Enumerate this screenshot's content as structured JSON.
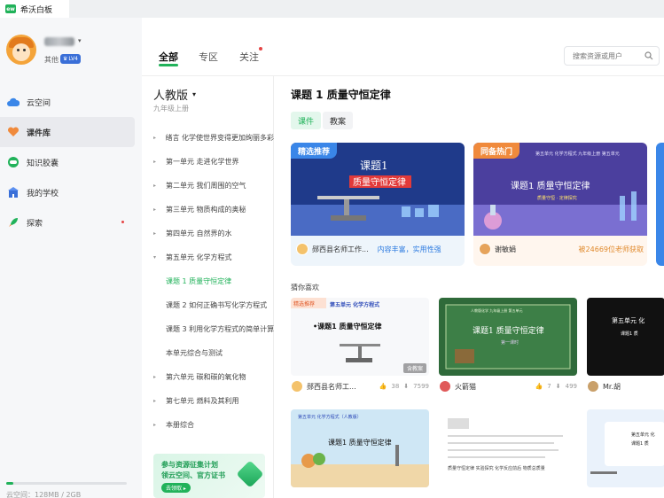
{
  "app": {
    "logo": "ew",
    "title": "希沃白板"
  },
  "user": {
    "role": "其他",
    "level": "LV4"
  },
  "nav": [
    {
      "label": "云空间",
      "icon": "cloud-icon",
      "color": "#3a86e8"
    },
    {
      "label": "课件库",
      "icon": "heart-icon",
      "color": "#f08a3c"
    },
    {
      "label": "知识胶囊",
      "icon": "capsule-icon",
      "color": "#21b25a"
    },
    {
      "label": "我的学校",
      "icon": "school-icon",
      "color": "#3a6fd8"
    },
    {
      "label": "探索",
      "icon": "rocket-icon",
      "color": "#21b25a"
    }
  ],
  "storage": {
    "text": "云空间：128MB / 2GB",
    "used_fraction": 0.06
  },
  "top_tabs": [
    "全部",
    "专区",
    "关注"
  ],
  "search": {
    "placeholder": "搜索资源或用户"
  },
  "textbook": {
    "edition": "人教版",
    "grade": "九年级上册"
  },
  "chapters": [
    {
      "label": "绪言 化学使世界变得更加绚丽多彩",
      "level": 0,
      "arrow": "▸"
    },
    {
      "label": "第一单元 走进化学世界",
      "level": 0,
      "arrow": "▸"
    },
    {
      "label": "第二单元 我们周围的空气",
      "level": 0,
      "arrow": "▸"
    },
    {
      "label": "第三单元 物质构成的奥秘",
      "level": 0,
      "arrow": "▸"
    },
    {
      "label": "第四单元 自然界的水",
      "level": 0,
      "arrow": "▸"
    },
    {
      "label": "第五单元 化学方程式",
      "level": 0,
      "arrow": "▾"
    },
    {
      "label": "课题 1 质量守恒定律",
      "level": 1,
      "current": true
    },
    {
      "label": "课题 2 如何正确书写化学方程式",
      "level": 1
    },
    {
      "label": "课题 3 利用化学方程式的简单计算",
      "level": 1
    },
    {
      "label": "本单元综合与测试",
      "level": 1
    },
    {
      "label": "第六单元 碳和碳的氧化物",
      "level": 0,
      "arrow": "▸"
    },
    {
      "label": "第七单元 燃料及其利用",
      "level": 0,
      "arrow": "▸"
    },
    {
      "label": "本册综合",
      "level": 0,
      "arrow": "▸"
    }
  ],
  "promo": {
    "line1": "参与资源征集计划",
    "line2": "领云空间、官方证书",
    "button": "去领取 ▸"
  },
  "lesson": {
    "title": "课题 1 质量守恒定律",
    "tabs": [
      "课件",
      "教案"
    ]
  },
  "recommended": [
    {
      "badge": "精选推荐",
      "badge_color": "#3a86e8",
      "slide_title": "课题1",
      "slide_subtitle": "质量守恒定律",
      "author": "郧西县名师工作...",
      "tag": "内容丰富，实用性强"
    },
    {
      "badge": "同备热门",
      "badge_color": "#f08a3c",
      "slide_header": "第五单元 化学方程式  九年级上册 第五单元",
      "slide_title": "课题1 质量守恒定律",
      "slide_subtitle": "质量守恒 · 定律探究",
      "author": "谢敏娟",
      "count": "被24669位老师获取"
    }
  ],
  "guess_label": "猜你喜欢",
  "resources": [
    {
      "badge": "精选推荐",
      "unit": "第五单元  化学方程式",
      "slide_title": "•课题1 质量守恒定律",
      "tag": "含教案",
      "author": "郧西县名师工...",
      "likes": "38",
      "views": "7599"
    },
    {
      "slide_header": "人教版化学 九年级上册 第五单元",
      "slide_title": "课题1  质量守恒定律",
      "slide_sub": "第一课时",
      "author": "火箭猫",
      "likes": "7",
      "views": "499"
    },
    {
      "slide_title": "第五单元  化",
      "slide_sub": "课题1  质",
      "author": "Mr.胡"
    },
    {
      "unit": "第五单元  化学方程式（人教版）",
      "slide_title": "课题1  质量守恒定律"
    },
    {
      "slide_text": "质量守恒定律 实验探究 化学反应前后 物质总质量"
    },
    {
      "slide_title": "第五单元  化",
      "slide_sub": "课题1 质"
    }
  ]
}
